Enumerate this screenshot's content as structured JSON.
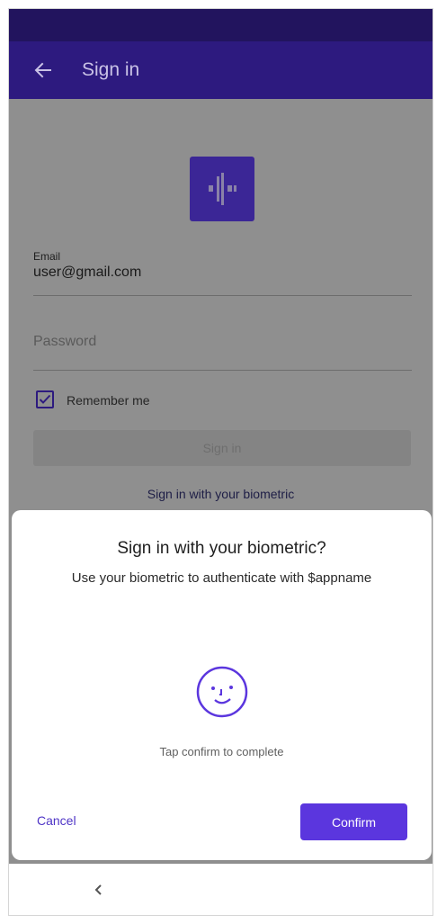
{
  "app_bar": {
    "title": "Sign in",
    "back_icon": "arrow-back-icon"
  },
  "form": {
    "logo_icon": "app-logo-icon",
    "email_label": "Email",
    "email_value": "user@gmail.com",
    "password_placeholder": "Password",
    "remember_label": "Remember me",
    "remember_checked": true,
    "signin_label": "Sign in",
    "biometric_link": "Sign in with your biometric"
  },
  "dialog": {
    "title": "Sign in with your biometric?",
    "description": "Use your biometric to authenticate with $appname",
    "face_icon": "face-icon",
    "hint": "Tap confirm to complete",
    "cancel_label": "Cancel",
    "confirm_label": "Confirm"
  },
  "nav": {
    "back_icon": "nav-back-icon"
  },
  "colors": {
    "app_bar": "#2d1a7f",
    "status_bar": "#22145e",
    "accent": "#5b36de",
    "scrim": "#8f8f8f"
  }
}
